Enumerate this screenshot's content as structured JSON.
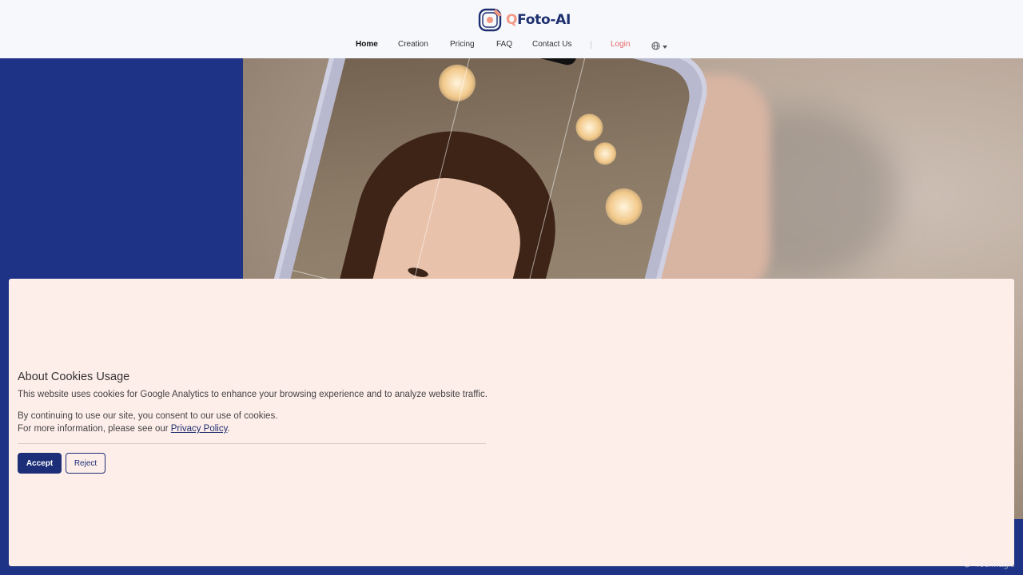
{
  "brand": {
    "logo_q": "Q",
    "logo_rest": "Foto-AI"
  },
  "nav": {
    "items": [
      {
        "label": "Home",
        "active": true
      },
      {
        "label": "Creation"
      },
      {
        "label": "Pricing"
      },
      {
        "label": "FAQ"
      },
      {
        "label": "Contact Us"
      }
    ],
    "login": "Login",
    "language_icon": "globe-icon"
  },
  "cookie": {
    "title": "About Cookies Usage",
    "line1": "This website uses cookies for Google Analytics to enhance your browsing experience and to analyze website traffic.",
    "line2": "By continuing to use our site, you consent to our use of cookies.",
    "line3_prefix": "For more information, please see our ",
    "line3_link": "Privacy Policy",
    "line3_suffix": ".",
    "accept": "Accept",
    "reject": "Reject"
  },
  "watermark": {
    "text": "ToolMagic"
  },
  "colors": {
    "brand": "#1e3385",
    "accent": "#e8656a",
    "banner": "#feeeea"
  }
}
